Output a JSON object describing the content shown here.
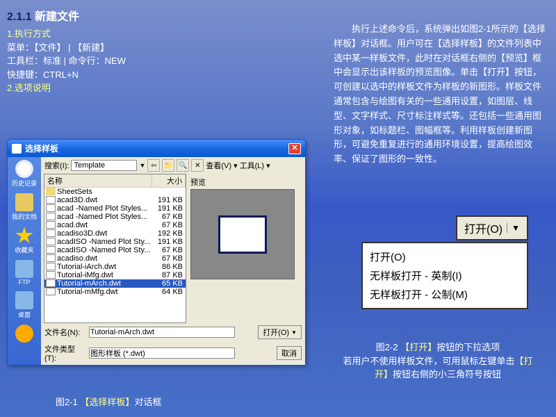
{
  "heading": {
    "num": "2.1.1",
    "text": "新建文件"
  },
  "left": {
    "l1": "1.执行方式",
    "l2": "菜单：【文件】 | 【新建】",
    "l3": "工具栏：标准 | 命令行：NEW",
    "l4": "快捷键：CTRL+N",
    "l5": "2.选项说明"
  },
  "right_para": "执行上述命令后，系统弹出如图2-1所示的【选择样板】对话框。用户可在【选择样板】的文件列表中选中某一样板文件，此时在对话框右侧的【预览】框中会显示出该样板的预览图像。单击【打开】按钮，可创建以选中的样板文件为样板的新图形。样板文件通常包含与绘图有关的一些通用设置，如图层、线型、文字样式、尺寸标注样式等。还包括一些通用图形对象，如标题栏、图幅框等。利用样板创建新图形，可避免重复进行的通用环境设置，提高绘图效率、保证了图形的一致性。",
  "dialog": {
    "title": "选择样板",
    "search_label": "搜索(I):",
    "search_val": "Template",
    "view_label": "查看(V)",
    "tools_label": "工具(L)",
    "preview_label": "预览",
    "col_name": "名称",
    "col_size": "大小",
    "filename_label": "文件名(N):",
    "filename_val": "Tutorial-mArch.dwt",
    "filetype_label": "文件类型(T):",
    "filetype_val": "图形样板 (*.dwt)",
    "open_btn": "打开(O)",
    "cancel_btn": "取消"
  },
  "sidebar": [
    {
      "icon": "clock",
      "label": "历史记录"
    },
    {
      "icon": "folder",
      "label": "我的文档"
    },
    {
      "icon": "star",
      "label": "收藏夹"
    },
    {
      "icon": "ftp",
      "label": "FTP"
    },
    {
      "icon": "desktop",
      "label": "桌面"
    },
    {
      "icon": "buzz",
      "label": ""
    }
  ],
  "files": [
    {
      "type": "folder",
      "name": "SheetSets",
      "size": ""
    },
    {
      "type": "dwt",
      "name": "acad3D.dwt",
      "size": "191 KB"
    },
    {
      "type": "dwt",
      "name": "acad -Named Plot Styles...",
      "size": "191 KB"
    },
    {
      "type": "dwt",
      "name": "acad -Named Plot Styles...",
      "size": "67 KB"
    },
    {
      "type": "dwt",
      "name": "acad.dwt",
      "size": "67 KB"
    },
    {
      "type": "dwt",
      "name": "acadiso3D.dwt",
      "size": "192 KB"
    },
    {
      "type": "dwt",
      "name": "acadISO -Named Plot Sty...",
      "size": "191 KB"
    },
    {
      "type": "dwt",
      "name": "acadISO -Named Plot Sty...",
      "size": "67 KB"
    },
    {
      "type": "dwt",
      "name": "acadiso.dwt",
      "size": "67 KB"
    },
    {
      "type": "dwt",
      "name": "Tutorial-iArch.dwt",
      "size": "86 KB"
    },
    {
      "type": "dwt",
      "name": "Tutorial-iMfg.dwt",
      "size": "87 KB"
    },
    {
      "type": "dwt",
      "name": "Tutorial-mArch.dwt",
      "size": "65 KB",
      "selected": true
    },
    {
      "type": "dwt",
      "name": "Tutorial-mMfg.dwt",
      "size": "64 KB"
    }
  ],
  "fig1": {
    "pre": "图2-1 ",
    "mid": "【选择样板】",
    "post": "对话框"
  },
  "open_menu": {
    "btn": "打开(O)",
    "items": [
      "打开(O)",
      "无样板打开 - 英制(I)",
      "无样板打开 - 公制(M)"
    ]
  },
  "fig2": {
    "line1a": "图2-2 ",
    "line1b": "【打开】",
    "line1c": "按钮的下拉选项",
    "line2a": "若用户不使用样板文件，可用鼠标左键单击",
    "line2b": "【打开】",
    "line2c": "按钮右侧的小三角符号按钮"
  }
}
